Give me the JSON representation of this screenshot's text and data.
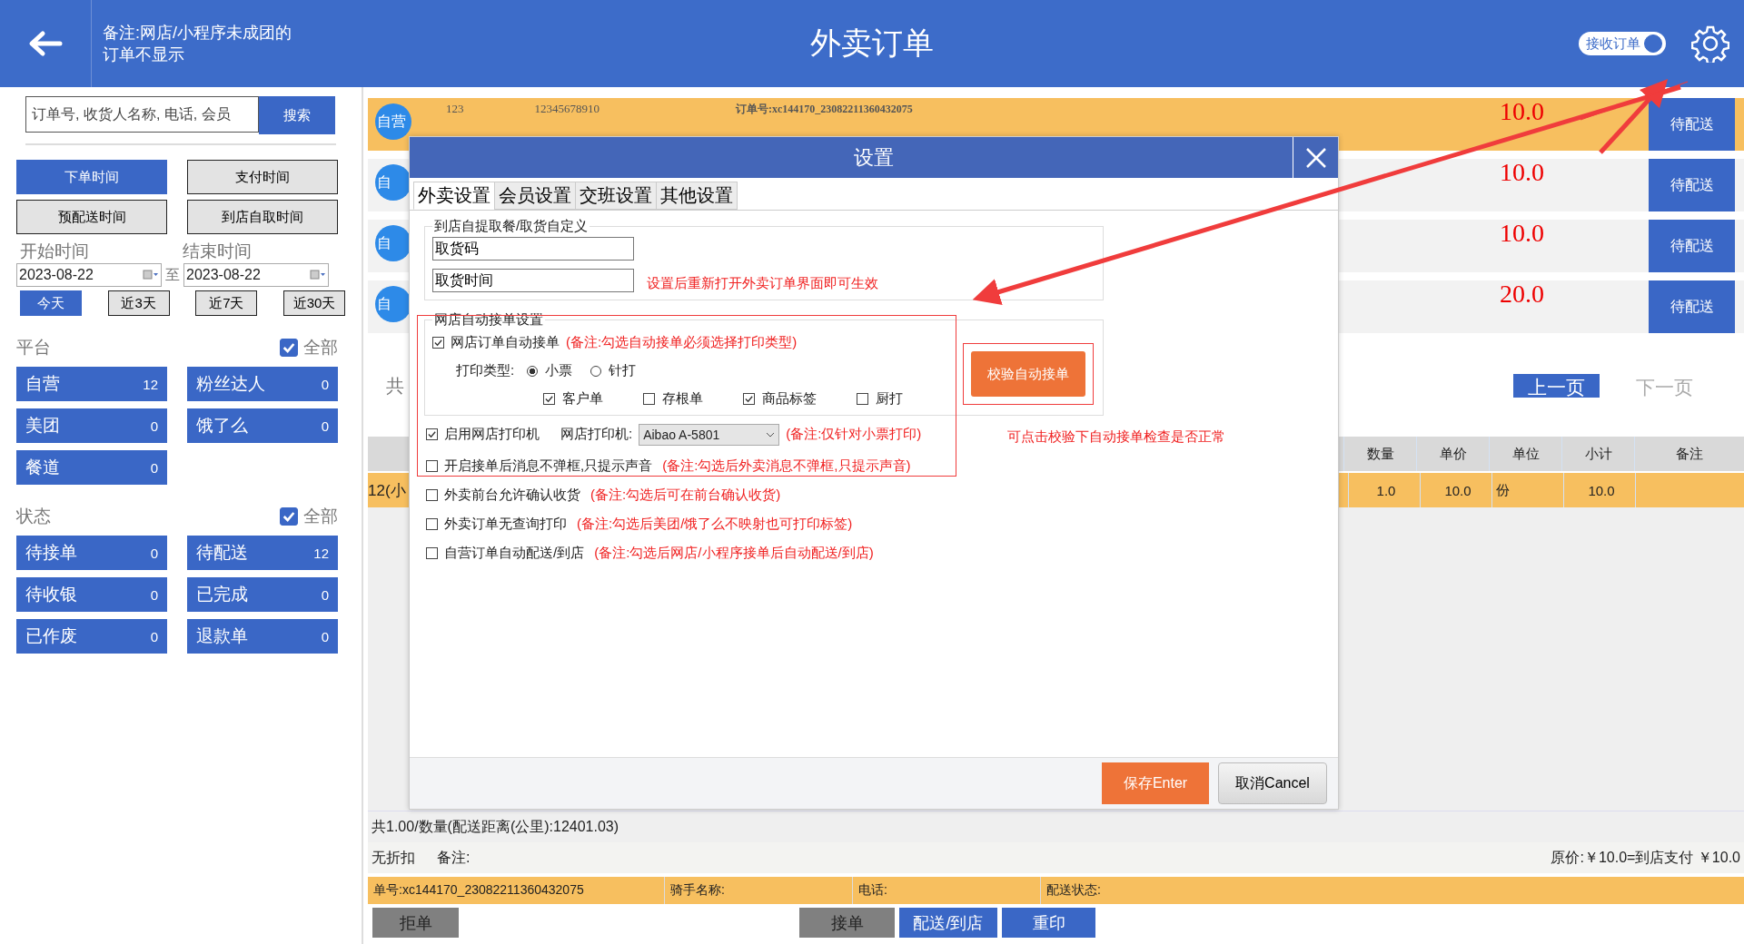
{
  "header": {
    "note": "备注:网店/小程序未成团的订单不显示",
    "title": "外卖订单",
    "toggle": {
      "label": "接收订单",
      "on": true
    }
  },
  "search": {
    "placeholder": "订单号, 收货人名称, 电话, 会员",
    "button": "搜索"
  },
  "time_filters": [
    {
      "label": "下单时间",
      "selected": true
    },
    {
      "label": "支付时间",
      "selected": false
    },
    {
      "label": "预配送时间",
      "selected": false
    },
    {
      "label": "到店自取时间",
      "selected": false
    }
  ],
  "date_range": {
    "start_label": "开始时间",
    "end_label": "结束时间",
    "start": "2023-08-22",
    "separator": "至",
    "end": "2023-08-22"
  },
  "quick_ranges": [
    {
      "label": "今天",
      "selected": true
    },
    {
      "label": "近3天",
      "selected": false
    },
    {
      "label": "近7天",
      "selected": false
    },
    {
      "label": "近30天",
      "selected": false
    }
  ],
  "platform": {
    "title": "平台",
    "all_label": "全部",
    "all_checked": true,
    "items": [
      {
        "label": "自营",
        "count": "12"
      },
      {
        "label": "粉丝达人",
        "count": "0"
      },
      {
        "label": "美团",
        "count": "0"
      },
      {
        "label": "饿了么",
        "count": "0"
      },
      {
        "label": "餐道",
        "count": "0"
      }
    ]
  },
  "status": {
    "title": "状态",
    "all_label": "全部",
    "all_checked": true,
    "items": [
      {
        "label": "待接单",
        "count": "0"
      },
      {
        "label": "待配送",
        "count": "12"
      },
      {
        "label": "待收银",
        "count": "0"
      },
      {
        "label": "已完成",
        "count": "0"
      },
      {
        "label": "已作废",
        "count": "0"
      },
      {
        "label": "退款单",
        "count": "0"
      }
    ]
  },
  "orders": [
    {
      "badge": "自营",
      "name": "123",
      "phone": "12345678910",
      "order_no": "订单号:xc144170_23082211360432075",
      "price": "10.0",
      "action": "待配送",
      "selected": true
    },
    {
      "badge": "自",
      "price": "10.0",
      "action": "待配送",
      "selected": false
    },
    {
      "badge": "自",
      "price": "10.0",
      "action": "待配送",
      "selected": false
    },
    {
      "badge": "自",
      "price": "20.0",
      "action": "待配送",
      "selected": false
    }
  ],
  "pager": {
    "total": "共",
    "prev": {
      "label": "上一页",
      "disabled": false
    },
    "next": {
      "label": "下一页",
      "disabled": true
    }
  },
  "items_table": {
    "columns": [
      "数量",
      "单价",
      "单位",
      "小计",
      "备注"
    ],
    "rows": [
      {
        "name": "12(小",
        "qty": "1.0",
        "price": "10.0",
        "unit": "份",
        "subtotal": "10.0"
      }
    ]
  },
  "summary": {
    "totals": "共1.00/数量(配送距离(公里):12401.03)",
    "discount": "无折扣",
    "remark_label": "备注:",
    "price_line": "原价:￥10.0=到店支付 ￥10.0"
  },
  "info_bar": [
    "单号:xc144170_23082211360432075",
    "骑手名称:",
    "电话:",
    "配送状态:"
  ],
  "actions": [
    {
      "label": "拒单",
      "disabled": true
    },
    {
      "label": "接单",
      "disabled": true
    },
    {
      "label": "配送/到店",
      "disabled": false
    },
    {
      "label": "重印",
      "disabled": false
    }
  ],
  "dialog": {
    "title": "设置",
    "tabs": [
      {
        "label": "外卖设置",
        "selected": true
      },
      {
        "label": "会员设置",
        "selected": false
      },
      {
        "label": "交班设置",
        "selected": false
      },
      {
        "label": "其他设置",
        "selected": false
      }
    ],
    "pickup_group": {
      "title": "到店自提取餐/取货自定义",
      "fields": [
        "取货码",
        "取货时间"
      ],
      "note": "设置后重新打开外卖订单界面即可生效"
    },
    "auto_group": {
      "title": "网店自动接单设置",
      "auto_accept": {
        "label": "网店订单自动接单",
        "checked": true,
        "note": "(备注:勾选自动接单必须选择打印类型)"
      },
      "print_type_label": "打印类型:",
      "print_types": [
        {
          "label": "小票",
          "selected": true
        },
        {
          "label": "针打",
          "selected": false
        }
      ],
      "copies": [
        {
          "label": "客户单",
          "checked": true
        },
        {
          "label": "存根单",
          "checked": false
        },
        {
          "label": "商品标签",
          "checked": true
        },
        {
          "label": "厨打",
          "checked": false
        }
      ],
      "verify_button": "校验自动接单"
    },
    "printer": {
      "label": "启用网店打印机",
      "checked": true,
      "printer_label": "网店打印机:",
      "printer_value": "Aibao A-5801",
      "note": "(备注:仅针对小票打印)"
    },
    "verify_note": "可点击校验下自动接单检查是否正常",
    "options": [
      {
        "label": "开启接单后消息不弹框,只提示声音",
        "checked": false,
        "note": "(备注:勾选后外卖消息不弹框,只提示声音)"
      },
      {
        "label": "外卖前台允许确认收货",
        "checked": false,
        "note": "(备注:勾选后可在前台确认收货)"
      },
      {
        "label": "外卖订单无查询打印",
        "checked": false,
        "note": "(备注:勾选后美团/饿了么不映射也可打印标签)"
      },
      {
        "label": "自营订单自动配送/到店",
        "checked": false,
        "note": "(备注:勾选后网店/小程序接单后自动配送/到店)"
      }
    ],
    "save": "保存Enter",
    "cancel": "取消Cancel"
  }
}
